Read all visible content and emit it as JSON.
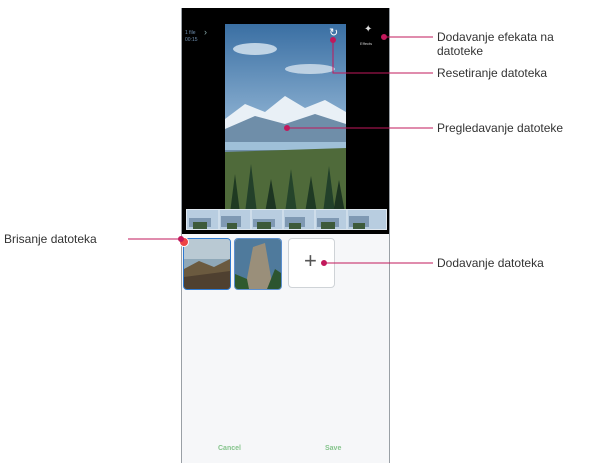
{
  "callouts": {
    "add_effects_line1": "Dodavanje efekata na",
    "add_effects_line2": "datoteke",
    "reset": "Resetiranje datoteka",
    "preview": "Pregledavanje datoteke",
    "delete": "Brisanje datoteka",
    "add": "Dodavanje datoteka"
  },
  "phone": {
    "top_left_text_1": "1 file",
    "top_left_text_2": "00:15",
    "effects_label": "Effects",
    "add_symbol": "+",
    "cancel_label": "Cancel",
    "save_label": "Save"
  },
  "colors": {
    "callout_line": "#c2185b",
    "accent_green": "#85c48c",
    "selection_blue": "#2f7ad1"
  }
}
